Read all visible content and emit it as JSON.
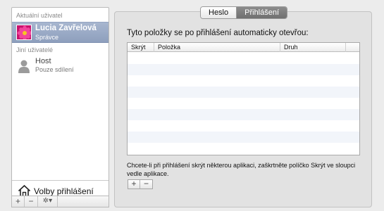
{
  "users": {
    "current_header": "Aktuální uživatel",
    "current": {
      "name": "Lucia Zavřelová",
      "role": "Správce"
    },
    "other_header": "Jiní uživatelé",
    "others": [
      {
        "name": "Host",
        "role": "Pouze sdílení"
      }
    ],
    "login_options_label": "Volby přihlášení",
    "toolbar": {
      "add": "+",
      "remove": "−",
      "action": "✲▾"
    }
  },
  "tabs": [
    {
      "label": "Heslo",
      "selected": false
    },
    {
      "label": "Přihlášení",
      "selected": true
    }
  ],
  "login_items": {
    "intro": "Tyto položky se po přihlášení automaticky otevřou:",
    "columns": [
      "Skrýt",
      "Položka",
      "Druh"
    ],
    "rows": [],
    "help": "Chcete-li při přihlášení skrýt některou aplikaci, zaškrtněte políčko Skrýt ve sloupci vedle aplikace.",
    "buttons": {
      "add": "+",
      "remove": "−"
    }
  },
  "colors": {
    "selection": "#9aaac6",
    "avatar_flower": "#d9177e",
    "selected_tab": "#7d7d7d",
    "alt_row": "#f2f5fa"
  },
  "icons": {
    "current_avatar": "pink-flower",
    "guest_avatar": "silhouette",
    "login_options": "house"
  }
}
